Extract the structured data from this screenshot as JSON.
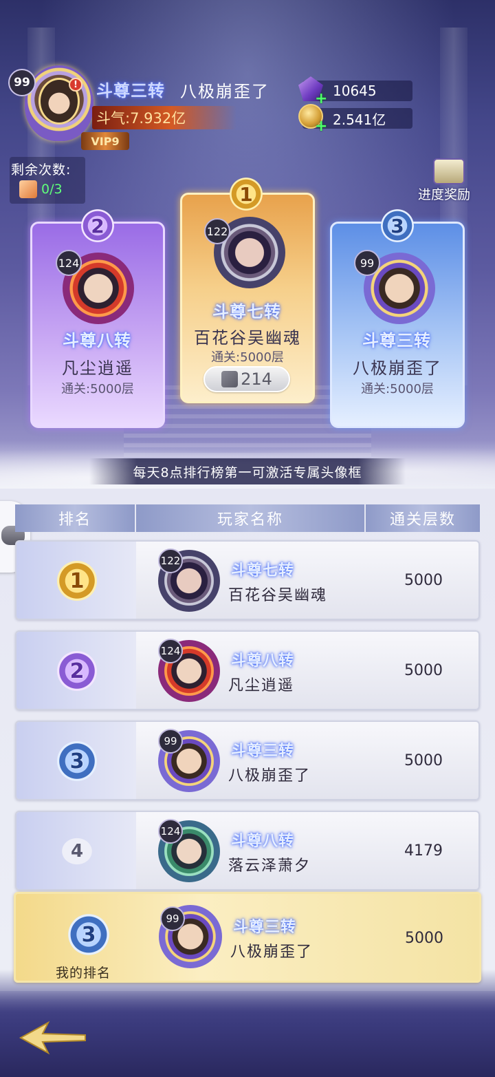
{
  "header": {
    "level": "99",
    "alert": "!",
    "vip": "VIP9",
    "rank_title": "斗尊三转",
    "player_name": "八极崩歪了",
    "power": "斗气:7.932亿",
    "gems": "10645",
    "coins": "2.541亿"
  },
  "remain": {
    "label": "剩余次数:",
    "value": "0/3"
  },
  "progress_reward": "进度奖励",
  "podium": [
    {
      "rank": "2",
      "level": "124",
      "title": "斗尊八转",
      "name": "凡尘逍遥",
      "cleared": "通关:5000层"
    },
    {
      "rank": "1",
      "level": "122",
      "title": "斗尊七转",
      "name": "百花谷吴幽魂",
      "cleared": "通关:5000层",
      "likes": "214"
    },
    {
      "rank": "3",
      "level": "99",
      "title": "斗尊三转",
      "name": "八极崩歪了",
      "cleared": "通关:5000层"
    }
  ],
  "notice": "每天8点排行榜第一可激活专属头像框",
  "table": {
    "headers": [
      "排名",
      "玩家名称",
      "通关层数"
    ],
    "rows": [
      {
        "rank": "1",
        "level": "122",
        "title": "斗尊七转",
        "name": "百花谷吴幽魂",
        "floors": "5000"
      },
      {
        "rank": "2",
        "level": "124",
        "title": "斗尊八转",
        "name": "凡尘逍遥",
        "floors": "5000"
      },
      {
        "rank": "3",
        "level": "99",
        "title": "斗尊三转",
        "name": "八极崩歪了",
        "floors": "5000"
      },
      {
        "rank": "4",
        "level": "124",
        "title": "斗尊八转",
        "name": "落云泽萧夕",
        "floors": "4179"
      }
    ]
  },
  "my_rank": {
    "rank": "3",
    "label": "我的排名",
    "level": "99",
    "title": "斗尊三转",
    "name": "八极崩歪了",
    "floors": "5000"
  },
  "colors": {
    "gold": "#d49a26",
    "purple": "#8a5bd4",
    "blue": "#3f6fc0",
    "title_glow": "#3b6cff",
    "green_count": "#5fff7a"
  }
}
